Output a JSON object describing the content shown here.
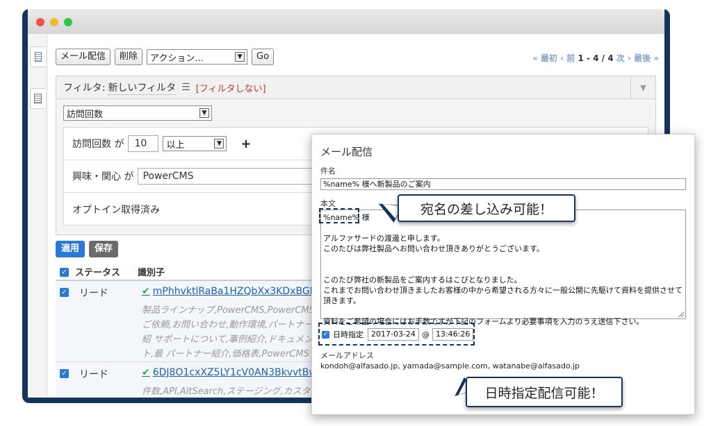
{
  "toolbar": {
    "send_mail": "メール配信",
    "delete": "削除",
    "action_select": "アクション...",
    "go": "Go"
  },
  "pager": {
    "first": "« 最初",
    "prev": "‹ 前",
    "range": "1 - 4 / 4",
    "next": "次 ›",
    "last": "最後 »"
  },
  "filter": {
    "label": "フィルタ:",
    "name": "新しいフィルタ",
    "no_filter": "[フィルタしない]",
    "rule_select": "訪問回数",
    "rules": {
      "visits_label": "訪問回数 が",
      "visits_value": "10",
      "visits_op": "以上",
      "interest_label": "興味・関心 が",
      "interest_value": "PowerCMS",
      "optin_label": "オプトイン取得済み"
    },
    "apply": "適用",
    "save": "保存"
  },
  "table": {
    "headers": [
      "ステータス",
      "識別子"
    ],
    "rows": [
      {
        "status": "リード",
        "id": "mPhhvktlRaBa1HZQbXx3KDxBGFAW",
        "tags": "製品ラインナップ,PowerCMS,PowerCMS ご依頼,お問い合わせ,動作環境,パートナー紹 サポートについて,事例紹介,ドキュメント,最 パートナー紹介,価格表,PowerCMS ご購入"
      },
      {
        "status": "リード",
        "id": "6DJ8O1cxXZ5LY1cV0AN3BkvvtBwjC",
        "tags": "件数,API,AltSearch,ステージング,カスタム ループ,プラグイン設定で,Data,動作環境,製品 ブ,PowerCMS,価格表,オプションサービス"
      }
    ]
  },
  "dialog": {
    "title": "メール配信",
    "subject_label": "件名",
    "subject_value": "%name% 様へ新製品のご案内",
    "body_label": "本文",
    "body_lines": [
      "%name% 様",
      "",
      "アルファサードの渡邊と申します。",
      "このたびは弊社製品へお問い合わせ頂きありがとうございます。",
      "",
      "",
      "このたび弊社の新製品をご案内するはこびとなりました。",
      "これまでお問い合わせ頂きましたお客様の中から希望される方々に一般公開に先駆けて資料を提供させて頂きます。",
      "",
      "資料をご希望の場合にはお手数ですが下記のフォームより必要事項を入力のうえ送信下さい。"
    ],
    "schedule_label": "日時指定",
    "schedule_date": "2017-03-24",
    "schedule_at": "@",
    "schedule_time": "13:46:26",
    "email_label": "メールアドレス",
    "email_value": "kondoh@alfasado.jp, yamada@sample.com, watanabe@alfasado.jp"
  },
  "callouts": {
    "name_insert": "宛名の差し込み可能！",
    "scheduled_send": "日時指定配信可能！"
  },
  "colors": {
    "frame": "#16345a",
    "link": "#1f5fb0",
    "apply": "#2a79d6",
    "ok": "#2bae3e"
  }
}
